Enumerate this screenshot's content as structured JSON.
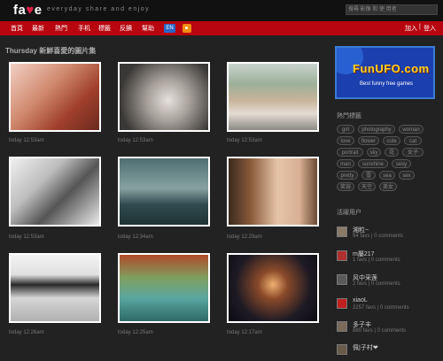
{
  "header": {
    "logo_prefix": "fa",
    "logo_heart": "♥",
    "logo_suffix": "e",
    "tagline": "everyday share and enjoy",
    "search_placeholder": "搜尋 影像 和 使 用者"
  },
  "nav": {
    "items": [
      "首頁",
      "最新",
      "熱門",
      "手机",
      "標籤",
      "反饋",
      "幫助"
    ],
    "lang_badge": "EN",
    "right_items": [
      "加入",
      "登入"
    ],
    "right_separator": "|"
  },
  "main": {
    "section_title": "Thursday 新鮮喜愛的圖片集",
    "photos": [
      {
        "time": "today 12:53am",
        "icon": "photo-girl-red-hair"
      },
      {
        "time": "today 12:53am",
        "icon": "photo-blonde-child"
      },
      {
        "time": "today 12:53am",
        "icon": "photo-girl-road"
      },
      {
        "time": "today 12:53am",
        "icon": "photo-girl-bw-sitting"
      },
      {
        "time": "today 12:34am",
        "icon": "photo-girl-water"
      },
      {
        "time": "today 12:29am",
        "icon": "photo-girl-flower"
      },
      {
        "time": "today 12:26am",
        "icon": "photo-girl-bw-hat"
      },
      {
        "time": "today 12:25am",
        "icon": "photo-girl-butterflies"
      },
      {
        "time": "today 12:17am",
        "icon": "photo-dark-street"
      }
    ]
  },
  "sidebar": {
    "ad": {
      "logo": "FunUFO.com",
      "tagline": "Best funny free games"
    },
    "tags_title": "熱門標籤",
    "tags": [
      "girl",
      "photography",
      "woman",
      "love",
      "flower",
      "cute",
      "cat",
      "portrait",
      "sky",
      "花",
      "女子",
      "man",
      "sunshine",
      "sexy",
      "pretty",
      "雪",
      "sea",
      "sex",
      "笑容",
      "天空",
      "美女"
    ],
    "users_title": "活躍用户",
    "users": [
      {
        "name": "湘粒~",
        "stats": "94 favs | 0 comments"
      },
      {
        "name": "m屬217",
        "stats": "1 favs | 0 comments"
      },
      {
        "name": "风中采莲",
        "stats": "2 favs | 0 comments"
      },
      {
        "name": "xiaoL",
        "stats": "2257 favs | 0 comments"
      },
      {
        "name": "多子丰",
        "stats": "880 favs | 0 comments"
      },
      {
        "name": "佩|子村❤",
        "stats": ""
      }
    ]
  },
  "colors": {
    "nav_bg": "#b8050f",
    "page_bg": "#222222",
    "heart": "#e0204a",
    "en_badge": "#2b66c7",
    "rss_badge": "#f08b12"
  }
}
